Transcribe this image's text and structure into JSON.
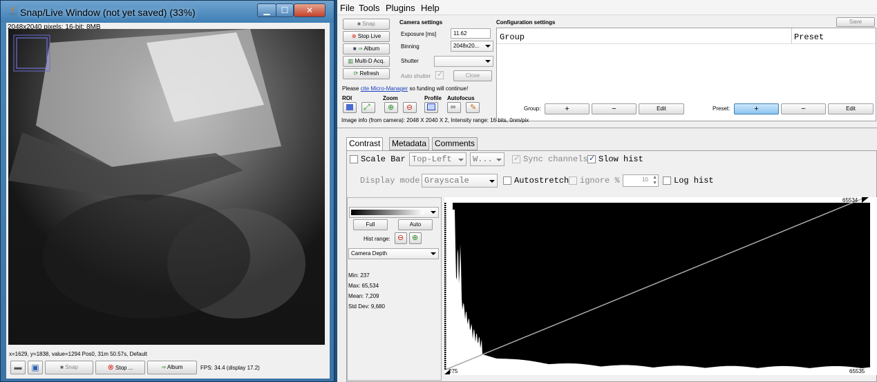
{
  "snap": {
    "title": "Snap/Live Window (not yet saved) (33%)",
    "pixel_info": "2048x2040 pixels; 16-bit; 8MB",
    "status": "x=1629, y=1838, value=1294    Pos0, 31m 50.57s, Default",
    "buttons": {
      "snap": "Snap",
      "stop": "Stop ...",
      "album": "Album"
    },
    "fps": "FPS: 34.4 (display 17.2)"
  },
  "menu": [
    "File",
    "Tools",
    "Plugins",
    "Help"
  ],
  "left_buttons": {
    "snap": "Snap",
    "stop_live": "Stop Live",
    "album": "Album",
    "multid": "Multi-D Acq.",
    "refresh": "Refresh"
  },
  "camera": {
    "heading": "Camera settings",
    "exposure_label": "Exposure [ms]",
    "exposure_value": "11.62",
    "binning_label": "Binning",
    "binning_value": "2048x20...",
    "shutter_label": "Shutter",
    "shutter_value": "",
    "auto_shutter_label": "Auto shutter",
    "close_label": "Close"
  },
  "cite": {
    "prefix": "Please ",
    "link": "cite Micro-Manager",
    "suffix": " so funding will continue!"
  },
  "section_labels": {
    "roi": "ROI",
    "zoom": "Zoom",
    "profile": "Profile",
    "autofocus": "Autofocus"
  },
  "config": {
    "heading": "Configuration settings",
    "save": "Save",
    "col_group": "Group",
    "col_preset": "Preset",
    "group_label": "Group:",
    "preset_label": "Preset:",
    "plus": "+",
    "minus": "−",
    "edit": "Edit"
  },
  "image_info": "Image info (from camera): 2048 X 2040 X 2, Intensity range: 16 bits, 0nm/pix",
  "tabs": [
    "Contrast",
    "Metadata",
    "Comments"
  ],
  "contrast": {
    "scale_bar": "Scale Bar",
    "position": "Top-Left",
    "color": "W...",
    "sync": "Sync channels",
    "slow_hist": "Slow hist",
    "display_mode_label": "Display mode:",
    "display_mode": "Grayscale",
    "autostretch": "Autostretch",
    "ignore": "ignore %",
    "ignore_value": "10",
    "log_hist": "Log hist",
    "full": "Full",
    "auto": "Auto",
    "hist_range": "Hist range:",
    "depth": "Camera Depth",
    "min": "Min: 237",
    "max": "Max: 65,534",
    "mean": "Mean: 7,209",
    "std": "Std Dev: 9,680",
    "hist_max_label": "65534",
    "hist_min_label": "275",
    "hist_range_end": "65535"
  },
  "colors": {
    "accent": "#3b73a8",
    "selected": "#8cc4f0"
  }
}
